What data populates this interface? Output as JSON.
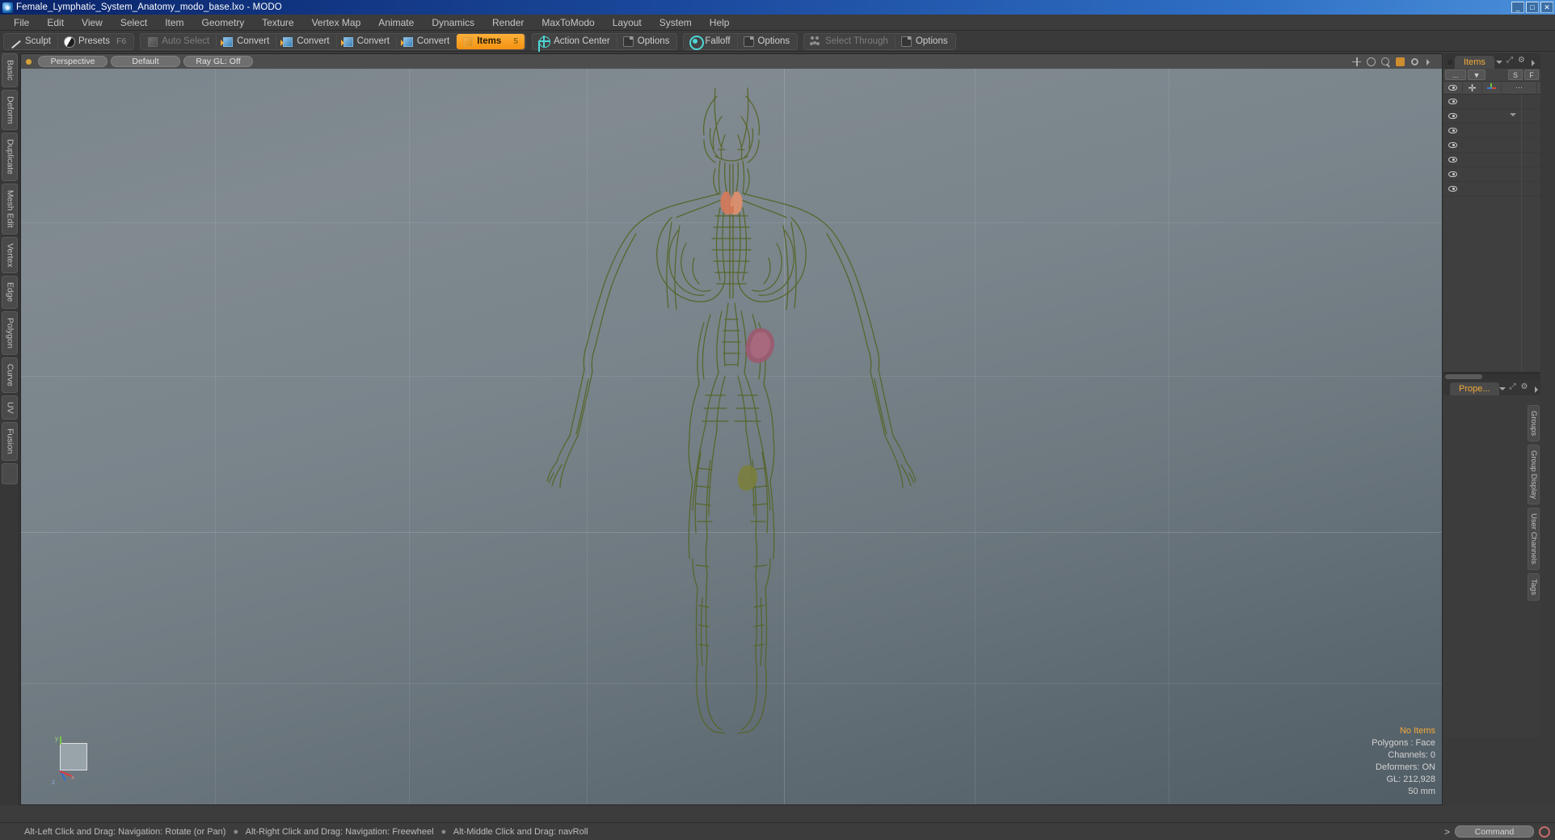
{
  "window": {
    "title": "Female_Lymphatic_System_Anatomy_modo_base.lxo - MODO",
    "app_icon": "modo-app-icon",
    "minimize": "_",
    "maximize": "□",
    "close": "✕"
  },
  "menubar": {
    "items": [
      {
        "label": "File"
      },
      {
        "label": "Edit"
      },
      {
        "label": "View"
      },
      {
        "label": "Select"
      },
      {
        "label": "Item"
      },
      {
        "label": "Geometry"
      },
      {
        "label": "Texture"
      },
      {
        "label": "Vertex Map"
      },
      {
        "label": "Animate"
      },
      {
        "label": "Dynamics"
      },
      {
        "label": "Render"
      },
      {
        "label": "MaxToModo"
      },
      {
        "label": "Layout"
      },
      {
        "label": "System"
      },
      {
        "label": "Help"
      }
    ]
  },
  "toolbar": {
    "groups": [
      {
        "buttons": [
          {
            "label": "Sculpt",
            "icon": "sculpt-icon",
            "state": "normal",
            "shortcut": ""
          },
          {
            "label": "Presets",
            "icon": "presets-sphere-icon",
            "state": "normal",
            "shortcut": "F6"
          }
        ]
      },
      {
        "buttons": [
          {
            "label": "Auto Select",
            "icon": "cube-grey-icon",
            "state": "dim",
            "shortcut": ""
          },
          {
            "label": "Convert",
            "icon": "convert-cube-icon",
            "state": "normal",
            "shortcut": ""
          },
          {
            "label": "Convert",
            "icon": "convert-cube-icon",
            "state": "normal",
            "shortcut": ""
          },
          {
            "label": "Convert",
            "icon": "convert-cube-icon",
            "state": "normal",
            "shortcut": ""
          },
          {
            "label": "Convert",
            "icon": "convert-cube-icon",
            "state": "normal",
            "shortcut": ""
          },
          {
            "label": "Items",
            "icon": "cube-orange-icon",
            "state": "active",
            "shortcut": "5"
          }
        ]
      },
      {
        "buttons": [
          {
            "label": "Action Center",
            "icon": "action-center-icon",
            "state": "normal",
            "shortcut": ""
          },
          {
            "label": "Options",
            "icon": "options-icon",
            "state": "normal",
            "shortcut": ""
          }
        ]
      },
      {
        "buttons": [
          {
            "label": "Falloff",
            "icon": "falloff-icon",
            "state": "normal",
            "shortcut": ""
          },
          {
            "label": "Options",
            "icon": "options-icon",
            "state": "normal",
            "shortcut": ""
          }
        ]
      },
      {
        "buttons": [
          {
            "label": "Select Through",
            "icon": "select-through-icon",
            "state": "dim",
            "shortcut": ""
          },
          {
            "label": "Options",
            "icon": "options-icon",
            "state": "normal",
            "shortcut": ""
          }
        ]
      }
    ]
  },
  "left_tabs": {
    "items": [
      {
        "label": "Basic"
      },
      {
        "label": "Deform"
      },
      {
        "label": "Duplicate"
      },
      {
        "label": "Mesh Edit"
      },
      {
        "label": "Vertex"
      },
      {
        "label": "Edge"
      },
      {
        "label": "Polygon"
      },
      {
        "label": "Curve"
      },
      {
        "label": "UV"
      },
      {
        "label": "Fusion"
      }
    ]
  },
  "viewport": {
    "view_mode": "Perspective",
    "shading_preset": "Default",
    "ray_gl": "Ray GL: Off",
    "header_icons": [
      "move-icon",
      "rotate-icon",
      "zoom-icon",
      "fit-icon",
      "gear-icon",
      "expand-icon"
    ],
    "gizmo": {
      "x_label": "x",
      "y_label": "y",
      "z_label": "z"
    },
    "info": {
      "selection": "No Items",
      "polygons": "Polygons : Face",
      "channels": "Channels: 0",
      "deformers": "Deformers: ON",
      "gl": "GL: 212,928",
      "grid": "50 mm"
    },
    "model_colors": {
      "lymphatic": "#5c6b2a",
      "thyroid": "#d98a6a",
      "spleen": "#a05a6e",
      "background_top": "#7b858c",
      "background_bottom": "#525e66"
    }
  },
  "right_panel": {
    "items_panel": {
      "tab_label": "Items",
      "toolbar": {
        "menu_dots": "...",
        "dropdown": "▼",
        "s_button": "S",
        "f_button": "F"
      },
      "columns": [
        {
          "name": "visibility",
          "icon": "eye-icon"
        },
        {
          "name": "lock",
          "icon": "plus-icon"
        },
        {
          "name": "axis",
          "icon": "axis-icon"
        },
        {
          "name": "more",
          "icon": "ellipsis-icon"
        }
      ],
      "rows": [
        {
          "visible": true
        },
        {
          "visible": true
        },
        {
          "visible": true
        },
        {
          "visible": true
        },
        {
          "visible": true
        },
        {
          "visible": true
        },
        {
          "visible": true
        }
      ]
    },
    "properties_panel": {
      "tab_label": "Prope...",
      "vtabs": [
        {
          "label": "Groups"
        },
        {
          "label": "Group Display"
        },
        {
          "label": "User Channels"
        },
        {
          "label": "Tags"
        }
      ]
    }
  },
  "statusbar": {
    "hints": [
      "Alt-Left Click and Drag: Navigation: Rotate (or Pan)",
      "Alt-Right Click and Drag: Navigation: Freewheel",
      "Alt-Middle Click and Drag: navRoll"
    ],
    "separator": "●",
    "command_caret": ">",
    "command_placeholder": "Command",
    "record_icon": "record-icon"
  }
}
